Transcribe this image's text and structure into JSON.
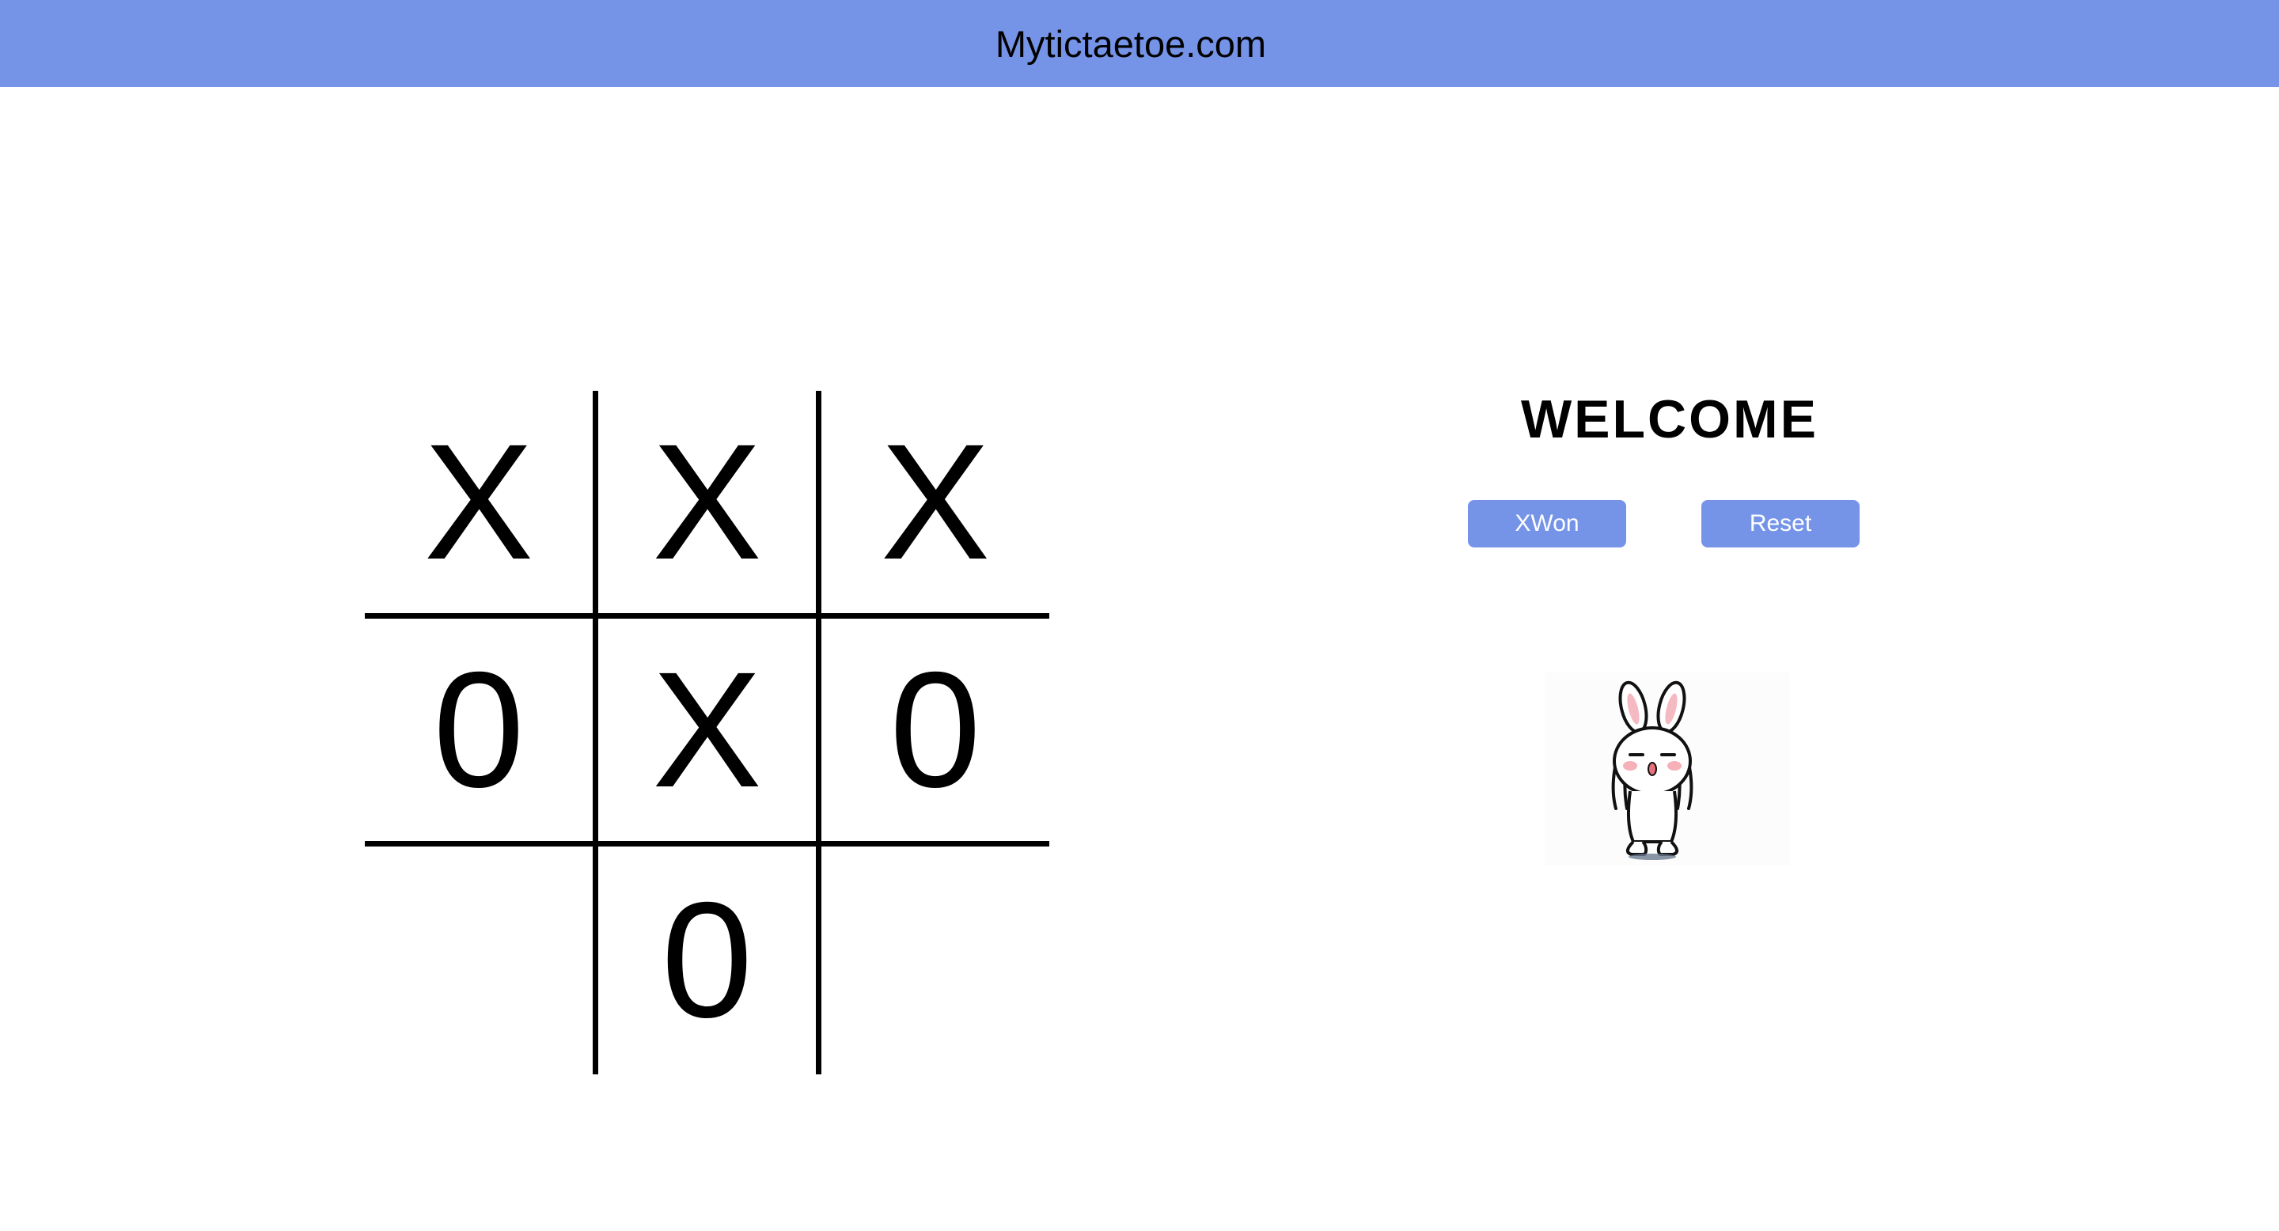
{
  "header": {
    "title": "Mytictaetoe.com",
    "bg_color": "#7594e8"
  },
  "board": {
    "cells": [
      [
        "X",
        "X",
        "X"
      ],
      [
        "0",
        "X",
        "0"
      ],
      [
        "",
        "0",
        ""
      ]
    ]
  },
  "panel": {
    "heading": "WELCOME",
    "status_button": "XWon",
    "reset_button": "Reset",
    "button_color": "#7594e8",
    "mascot": "bunny-celebrating-icon"
  }
}
